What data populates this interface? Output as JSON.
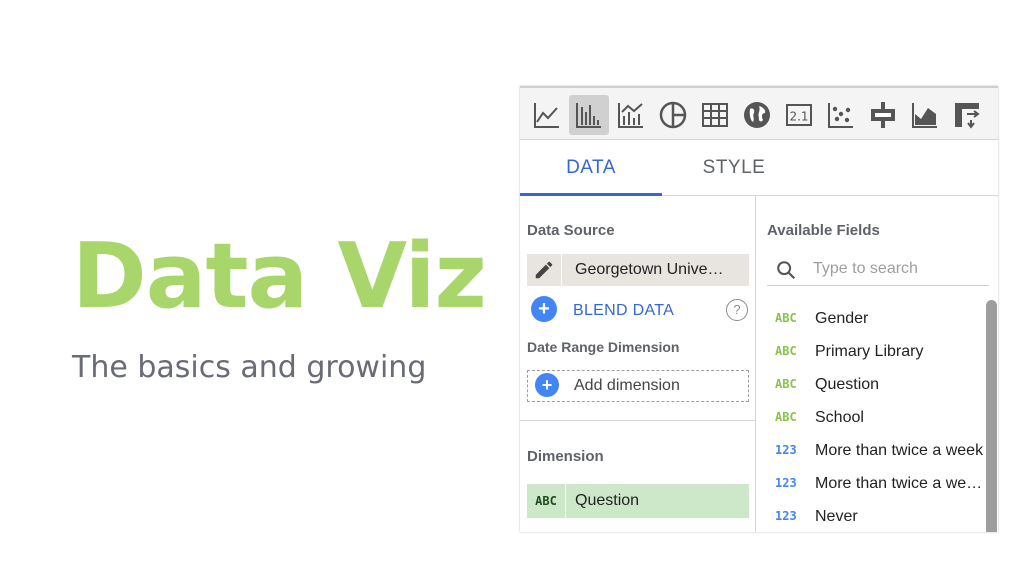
{
  "slide": {
    "title": "Data Viz",
    "subtitle": "The basics and growing",
    "title_color": "#a8d66b"
  },
  "toolbar": {
    "chart_types": [
      {
        "icon": "line-chart-icon",
        "active": false
      },
      {
        "icon": "bar-chart-icon",
        "active": true
      },
      {
        "icon": "combo-chart-icon",
        "active": false
      },
      {
        "icon": "pie-chart-icon",
        "active": false
      },
      {
        "icon": "table-icon",
        "active": false
      },
      {
        "icon": "geo-map-icon",
        "active": false
      },
      {
        "icon": "scorecard-icon",
        "scorecard_label": "2.1",
        "active": false
      },
      {
        "icon": "scatter-chart-icon",
        "active": false
      },
      {
        "icon": "bullet-chart-icon",
        "active": false
      },
      {
        "icon": "area-chart-icon",
        "active": false
      },
      {
        "icon": "pivot-table-icon",
        "active": false
      }
    ]
  },
  "tabs": [
    {
      "label": "DATA",
      "active": true
    },
    {
      "label": "STYLE",
      "active": false
    }
  ],
  "data_panel": {
    "data_source_label": "Data Source",
    "data_source_name": "Georgetown Unive…",
    "blend_label": "BLEND DATA",
    "help_glyph": "?",
    "date_range_label": "Date Range Dimension",
    "add_dimension_label": "Add dimension",
    "dimension_label": "Dimension",
    "dimension": {
      "type": "ABC",
      "name": "Question"
    }
  },
  "fields_panel": {
    "label": "Available Fields",
    "search_placeholder": "Type to search",
    "fields": [
      {
        "type": "ABC",
        "name": "Gender"
      },
      {
        "type": "ABC",
        "name": "Primary Library"
      },
      {
        "type": "ABC",
        "name": "Question"
      },
      {
        "type": "ABC",
        "name": "School"
      },
      {
        "type": "123",
        "name": "More than twice a week"
      },
      {
        "type": "123",
        "name": "More than twice a we…"
      },
      {
        "type": "123",
        "name": "Never"
      }
    ]
  },
  "colors": {
    "accent_blue": "#3367d6",
    "plus_blue": "#4285f4",
    "text_type_green": "#8bc34a",
    "number_type_blue": "#4285f4",
    "dimension_chip_bg": "#cce8c9"
  }
}
